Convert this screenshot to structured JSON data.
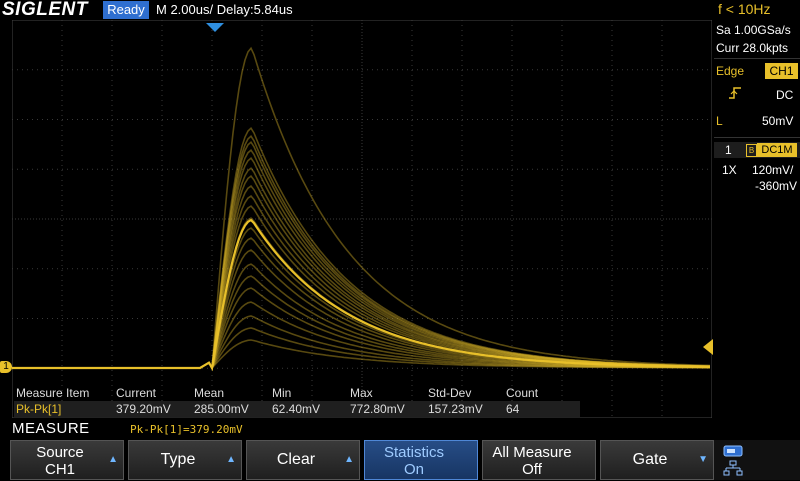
{
  "header": {
    "brand": "SIGLENT",
    "status": "Ready",
    "timebase": "M 2.00us/",
    "delay": "Delay:5.84us",
    "frequency": "f < 10Hz"
  },
  "acquisition": {
    "sample_rate": "Sa 1.00GSa/s",
    "memory": "Curr 28.0kpts"
  },
  "trigger": {
    "type": "Edge",
    "source": "CH1",
    "coupling": "DC",
    "level_label": "L",
    "level": "50mV"
  },
  "channel": {
    "number": "1",
    "bw_mark": "B",
    "coupling": "DC1M",
    "probe": "1X",
    "scale": "120mV/",
    "offset": "-360mV"
  },
  "channel_marker": "1",
  "measure_table": {
    "headers": [
      "Measure Item",
      "Current",
      "Mean",
      "Min",
      "Max",
      "Std-Dev",
      "Count"
    ],
    "row": [
      "Pk-Pk[1]",
      "379.20mV",
      "285.00mV",
      "62.40mV",
      "772.80mV",
      "157.23mV",
      "64"
    ]
  },
  "menu": {
    "title": "MEASURE",
    "status_text": "Pk-Pk[1]=379.20mV"
  },
  "softkeys": [
    {
      "line1": "Source",
      "line2": "CH1",
      "arrow": "▲"
    },
    {
      "line1": "Type",
      "line2": "",
      "arrow": "▲"
    },
    {
      "line1": "Clear",
      "line2": "",
      "arrow": "▲"
    },
    {
      "line1": "Statistics",
      "line2": "On",
      "arrow": ""
    },
    {
      "line1": "All Measure",
      "line2": "Off",
      "arrow": ""
    },
    {
      "line1": "Gate",
      "line2": "",
      "arrow": "▼"
    }
  ],
  "colors": {
    "channel1": "#e8c02a",
    "active_key": "#2f6fd0",
    "grid": "#3a3a3a"
  }
}
